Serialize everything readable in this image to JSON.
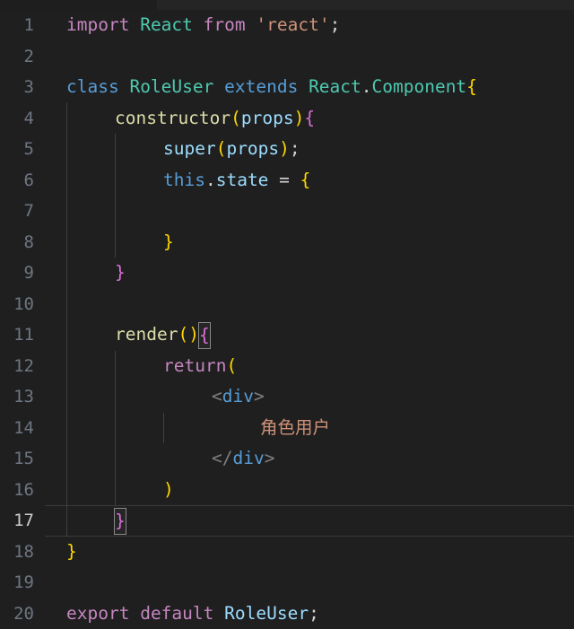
{
  "editor": {
    "theme_name": "vscode-dark",
    "background": "#1f1f1f",
    "gutter_color": "#6e7681",
    "current_line": 17,
    "cursor_line": 17,
    "language": "javascriptreact",
    "tab_size": 4
  },
  "lines": [
    {
      "num": "1",
      "indent": 0,
      "text": "import React from 'react';"
    },
    {
      "num": "2",
      "indent": 0,
      "text": ""
    },
    {
      "num": "3",
      "indent": 0,
      "text": "class RoleUser extends React.Component{"
    },
    {
      "num": "4",
      "indent": 1,
      "text": "constructor(props){"
    },
    {
      "num": "5",
      "indent": 2,
      "text": "super(props);"
    },
    {
      "num": "6",
      "indent": 2,
      "text": "this.state = {"
    },
    {
      "num": "7",
      "indent": 0,
      "text": ""
    },
    {
      "num": "8",
      "indent": 2,
      "text": "}"
    },
    {
      "num": "9",
      "indent": 1,
      "text": "}"
    },
    {
      "num": "10",
      "indent": 0,
      "text": ""
    },
    {
      "num": "11",
      "indent": 1,
      "text": "render(){"
    },
    {
      "num": "12",
      "indent": 2,
      "text": "return("
    },
    {
      "num": "13",
      "indent": 3,
      "text": "<div>"
    },
    {
      "num": "14",
      "indent": 4,
      "text": "角色用户"
    },
    {
      "num": "15",
      "indent": 3,
      "text": "</div>"
    },
    {
      "num": "16",
      "indent": 2,
      "text": ")"
    },
    {
      "num": "17",
      "indent": 1,
      "text": "}"
    },
    {
      "num": "18",
      "indent": 0,
      "text": "}"
    },
    {
      "num": "19",
      "indent": 0,
      "text": ""
    },
    {
      "num": "20",
      "indent": 0,
      "text": "export default RoleUser;"
    }
  ],
  "tokens": {
    "l1": {
      "import": "import",
      "react_id": "React",
      "from": "from",
      "module": "'react'",
      "semi": ";"
    },
    "l3": {
      "class": "class",
      "name": "RoleUser",
      "extends": "extends",
      "react": "React",
      "dot": ".",
      "component": "Component",
      "brace": "{"
    },
    "l4": {
      "constructor": "constructor",
      "lparen": "(",
      "props": "props",
      "rparen": ")",
      "brace": "{"
    },
    "l5": {
      "super": "super",
      "lparen": "(",
      "props": "props",
      "rparen": ")",
      "semi": ";"
    },
    "l6": {
      "this": "this",
      "dot": ".",
      "state": "state",
      "eq": "=",
      "brace": "{"
    },
    "l8": {
      "brace": "}"
    },
    "l9": {
      "brace": "}"
    },
    "l11": {
      "render": "render",
      "lparen": "(",
      "rparen": ")",
      "brace": "{"
    },
    "l12": {
      "return": "return",
      "lparen": "("
    },
    "l13": {
      "lt": "<",
      "tag": "div",
      "gt": ">"
    },
    "l14": {
      "text": "角色用户"
    },
    "l15": {
      "lt": "</",
      "tag": "div",
      "gt": ">"
    },
    "l16": {
      "rparen": ")"
    },
    "l17": {
      "brace": "}"
    },
    "l18": {
      "brace": "}"
    },
    "l20": {
      "export": "export",
      "default": "default",
      "name": "RoleUser",
      "semi": ";"
    }
  },
  "colors": {
    "background": "#1f1f1f",
    "foreground": "#d4d4d4",
    "keyword_control": "#c586c0",
    "keyword": "#569cd6",
    "type": "#4ec9b0",
    "string": "#ce9178",
    "variable": "#9cdcfe",
    "function": "#dcdcaa",
    "tag_punctuation": "#808080",
    "line_number": "#6e7681",
    "indent_guide": "#404040",
    "bracket_match_border": "#888888",
    "current_line_border": "#3a3a3a"
  }
}
